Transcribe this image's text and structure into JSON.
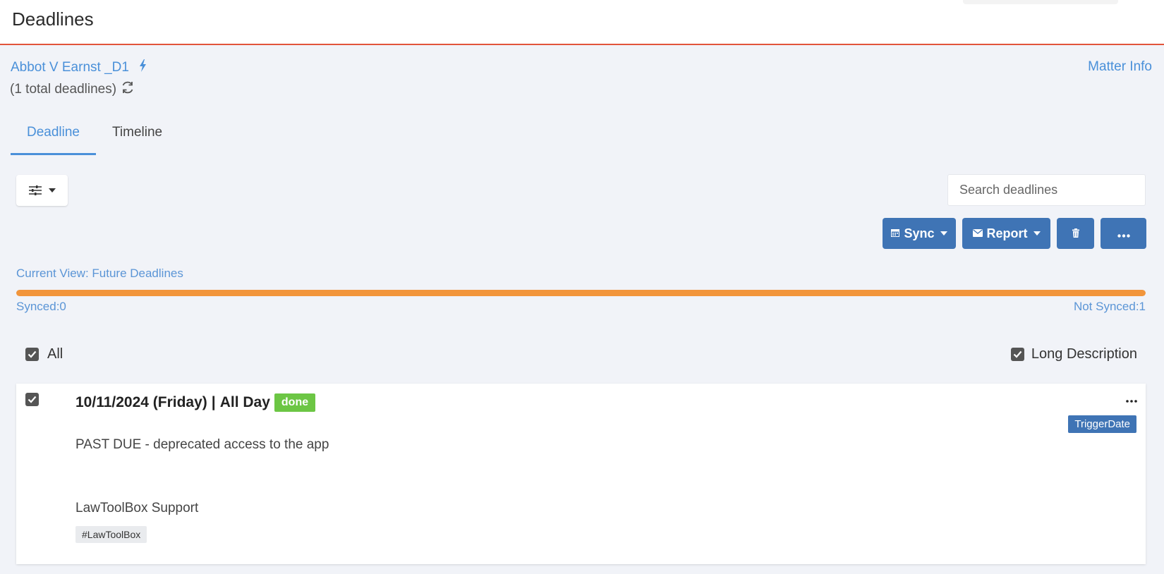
{
  "header": {
    "title": "Deadlines"
  },
  "matter": {
    "name": "Abbot V Earnst _D1",
    "bolt_icon": "bolt-icon",
    "total_deadlines": "(1 total deadlines)",
    "refresh_icon": "refresh-icon",
    "info_link": "Matter Info"
  },
  "tabs": [
    {
      "label": "Deadline",
      "active": true
    },
    {
      "label": "Timeline",
      "active": false
    }
  ],
  "toolbar": {
    "filter_icon": "sliders-icon",
    "search_placeholder": "Search deadlines",
    "sync_label": "Sync",
    "sync_icon": "calendar-icon",
    "report_label": "Report",
    "report_icon": "envelope-icon",
    "delete_icon": "trash-icon",
    "more_icon": "ellipsis-icon"
  },
  "status": {
    "current_view": "Current View: Future Deadlines",
    "synced": "Synced:0",
    "not_synced": "Not Synced:1",
    "not_synced_fraction": 1.0,
    "bar_color": "#f2953b"
  },
  "options": {
    "all_label": "All",
    "all_checked": true,
    "long_description_label": "Long Description",
    "long_description_checked": true
  },
  "deadlines": [
    {
      "checked": true,
      "date": "10/11/2024 (Friday)",
      "separator": "|",
      "time": "All Day",
      "status_badge": "done",
      "trigger_badge": "TriggerDate",
      "description": "PAST DUE - deprecated access to the app",
      "author": "LawToolBox Support",
      "tag": "#LawToolBox"
    }
  ],
  "colors": {
    "accent": "#4a90d9",
    "button": "#3f74b5",
    "header_border": "#e2543b",
    "done_badge": "#6cc644"
  }
}
